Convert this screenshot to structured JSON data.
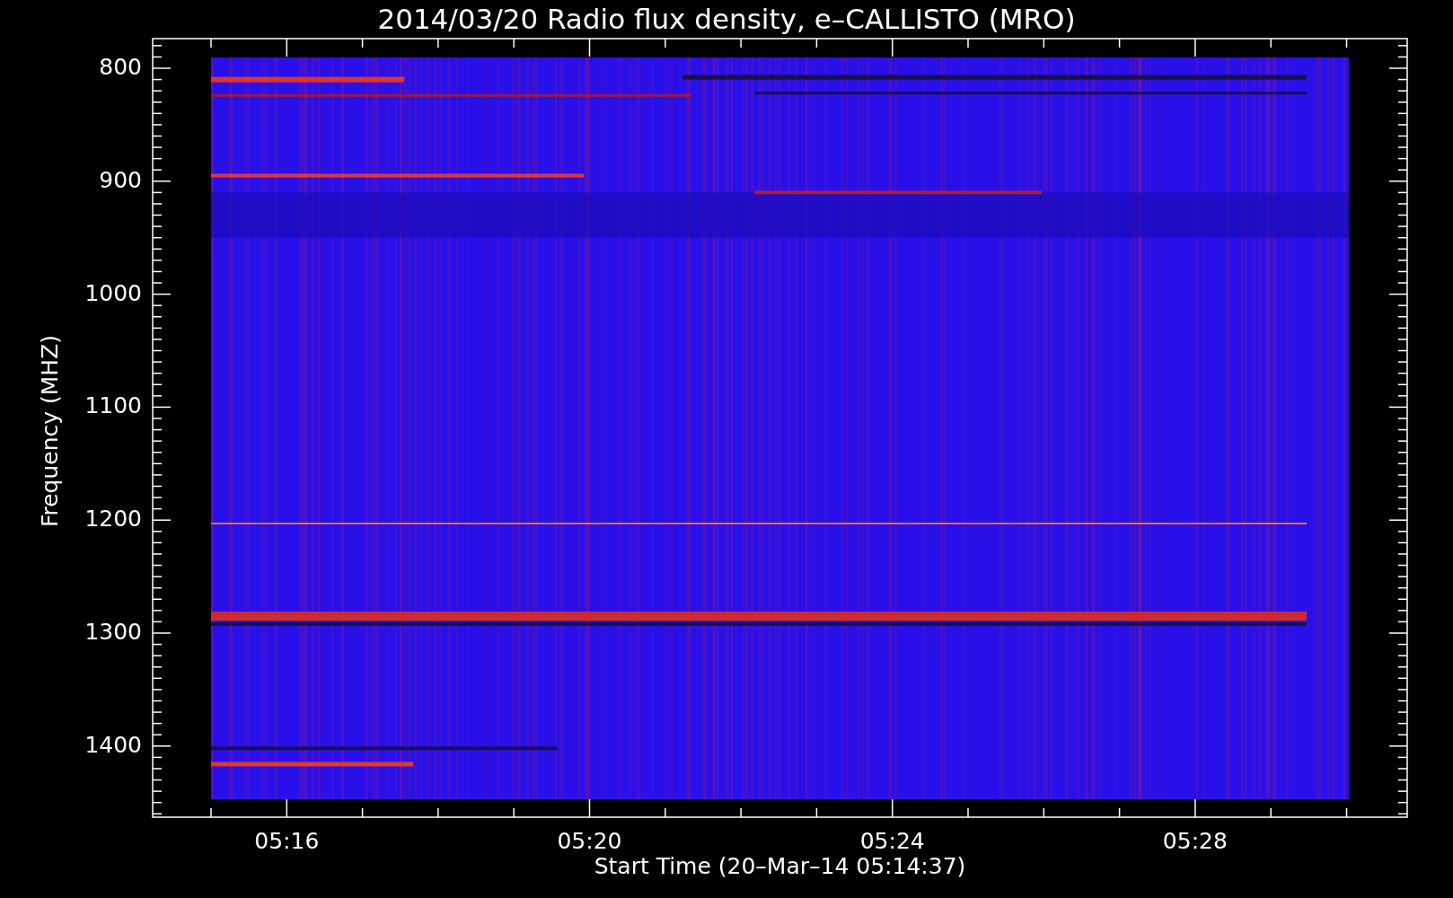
{
  "title": "2014/03/20  Radio flux density, e–CALLISTO (MRO)",
  "y_axis": {
    "label": "Frequency (MHZ)",
    "ticks": [
      "800",
      "900",
      "1000",
      "1100",
      "1200",
      "1300",
      "1400"
    ]
  },
  "x_axis": {
    "label": "Start Time (20–Mar–14 05:14:37)",
    "ticks": [
      "05:16",
      "05:20",
      "05:24",
      "05:28"
    ]
  }
}
